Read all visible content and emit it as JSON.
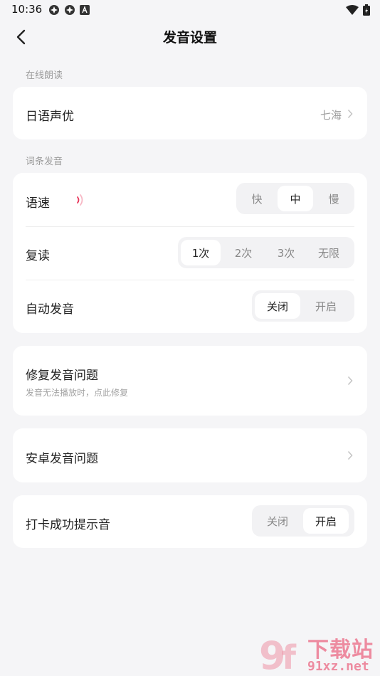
{
  "status_bar": {
    "time": "10:36",
    "left_icons": [
      "app-notification-icon",
      "app-notification-icon",
      "text-a-icon"
    ],
    "right_icons": [
      "wifi-icon",
      "battery-icon"
    ]
  },
  "header": {
    "title": "发音设置",
    "back_icon": "chevron-left-icon"
  },
  "sections": {
    "online_reading": {
      "label": "在线朗读"
    },
    "word_pronunciation": {
      "label": "词条发音"
    }
  },
  "voice_actor": {
    "label": "日语声优",
    "value": "七海"
  },
  "speed": {
    "label": "语速",
    "options": [
      "快",
      "中",
      "慢"
    ],
    "selected": "中"
  },
  "repeat": {
    "label": "复读",
    "options": [
      "1次",
      "2次",
      "3次",
      "无限"
    ],
    "selected": "1次"
  },
  "auto_play": {
    "label": "自动发音",
    "options": [
      "关闭",
      "开启"
    ],
    "selected": "关闭"
  },
  "fix_issue": {
    "label": "修复发音问题",
    "sub": "发音无法播放时，点此修复"
  },
  "android_issue": {
    "label": "安卓发音问题"
  },
  "checkin_sound": {
    "label": "打卡成功提示音",
    "options": [
      "关闭",
      "开启"
    ],
    "selected": "开启"
  },
  "watermark": {
    "text_top": "下载站",
    "text_bottom": "91xz.net"
  },
  "colors": {
    "accent": "#e8355a",
    "background": "#f5f5f7",
    "card": "#ffffff"
  }
}
